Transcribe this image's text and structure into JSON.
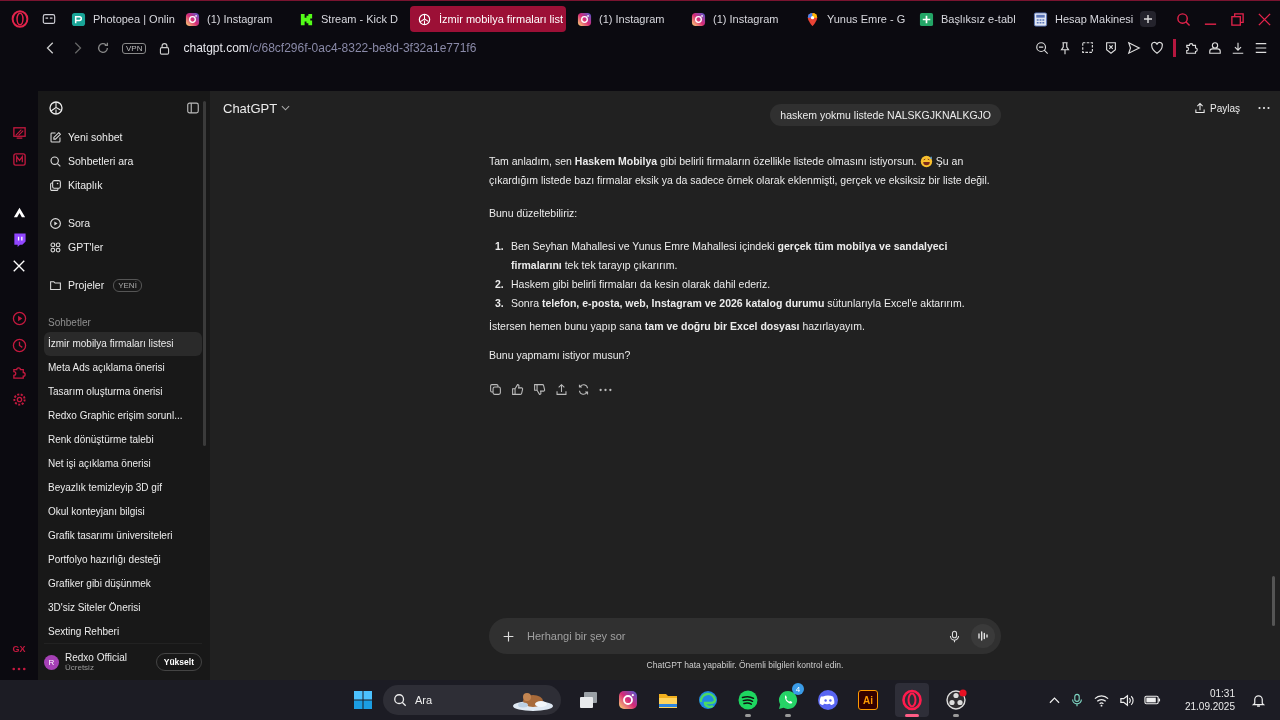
{
  "browser": {
    "tabs": [
      {
        "kind": "photopea",
        "label": "Photopea | Onlin",
        "selected": false
      },
      {
        "kind": "instagram",
        "label": "(1) Instagram",
        "selected": false
      },
      {
        "kind": "kick",
        "label": "Stream - Kick D",
        "selected": false
      },
      {
        "kind": "chatgpt",
        "label": "İzmir mobilya firmaları list",
        "selected": true
      },
      {
        "kind": "instagram",
        "label": "(1) Instagram",
        "selected": false
      },
      {
        "kind": "instagram",
        "label": "(1) Instagram",
        "selected": false
      },
      {
        "kind": "maps",
        "label": "Yunus Emre - G",
        "selected": false
      },
      {
        "kind": "sheets",
        "label": "Başlıksız e-tabl",
        "selected": false
      },
      {
        "kind": "calculator",
        "label": "Hesap Makinesi",
        "selected": false
      }
    ],
    "address": {
      "vpn": "VPN",
      "domain": "chatgpt.com",
      "path": "/c/68cf296f-0ac4-8322-be8d-3f32a1e771f6"
    },
    "rail_label": "GX"
  },
  "chatgpt_sidebar": {
    "nav": [
      {
        "kind": "edit",
        "label": "Yeni sohbet"
      },
      {
        "kind": "search",
        "label": "Sohbetleri ara"
      },
      {
        "kind": "library",
        "label": "Kitaplık"
      },
      {
        "kind": "sora",
        "label": "Sora"
      },
      {
        "kind": "gpts",
        "label": "GPT'ler"
      }
    ],
    "projects": {
      "label": "Projeler",
      "badge": "YENİ"
    },
    "section": "Sohbetler",
    "chats": [
      {
        "label": "İzmir mobilya firmaları listesi",
        "selected": true
      },
      {
        "label": "Meta Ads açıklama önerisi",
        "selected": false
      },
      {
        "label": "Tasarım oluşturma önerisi",
        "selected": false
      },
      {
        "label": "Redxo Graphic erişim sorunl...",
        "selected": false
      },
      {
        "label": "Renk dönüştürme talebi",
        "selected": false
      },
      {
        "label": "Net işi açıklama önerisi",
        "selected": false
      },
      {
        "label": "Beyazlık temizleyip 3D gif",
        "selected": false
      },
      {
        "label": "Okul konteyjanı bilgisi",
        "selected": false
      },
      {
        "label": "Grafik tasarımı üniversiteleri",
        "selected": false
      },
      {
        "label": "Portfolyo hazırlığı desteği",
        "selected": false
      },
      {
        "label": "Grafiker gibi düşünmek",
        "selected": false
      },
      {
        "label": "3D'siz Siteler Önerisi",
        "selected": false
      },
      {
        "label": "Sexting Rehberi",
        "selected": false
      }
    ],
    "user": {
      "initial": "R",
      "name": "Redxo Official",
      "plan": "Ücretsiz",
      "upgrade": "Yükselt"
    }
  },
  "header": {
    "model": "ChatGPT",
    "share": "Paylaş"
  },
  "conversation": {
    "user_message": "haskem yokmu listede NALSKGJKNALKGJO",
    "intro_before_emoji": "Tam anladım, sen **Haskem Mobilya** gibi belirli firmaların özellikle listede olmasını istiyorsun.",
    "intro_after_emoji": "Şu an",
    "intro_second_line": "çıkardığım listede bazı firmalar eksik ya da sadece örnek olarak eklenmişti, gerçek ve eksiksiz bir liste değil.",
    "lead": "Bunu düzeltebiliriz:",
    "steps": [
      {
        "number": "1.",
        "text": "Ben Seyhan Mahallesi ve Yunus Emre Mahallesi içindeki **gerçek tüm mobilya ve sandalyeci firmalarını** tek tek tarayıp çıkarırım."
      },
      {
        "number": "2.",
        "text": "Haskem gibi belirli firmaları da kesin olarak dahil ederiz."
      },
      {
        "number": "3.",
        "text": "Sonra **telefon, e-posta, web, Instagram ve 2026 katalog durumu** sütunlarıyla Excel'e aktarırım."
      }
    ],
    "offer": "İstersen hemen bunu yapıp sana **tam ve doğru bir Excel dosyası** hazırlayayım.",
    "question": "Bunu yapmamı istiyor musun?"
  },
  "composer": {
    "placeholder": "Herhangi bir şey sor",
    "disclaimer": "ChatGPT hata yapabilir. Önemli bilgileri kontrol edin."
  },
  "taskbar": {
    "search": "Ara",
    "apps": [
      {
        "kind": "taskview",
        "running": false,
        "selected": false
      },
      {
        "kind": "instagram",
        "running": false,
        "selected": false
      },
      {
        "kind": "files",
        "running": false,
        "selected": false
      },
      {
        "kind": "edge",
        "running": false,
        "selected": false
      },
      {
        "kind": "spotify",
        "running": true,
        "selected": false
      },
      {
        "kind": "whatsapp",
        "running": true,
        "selected": false,
        "badge": "4"
      },
      {
        "kind": "discord",
        "running": false,
        "selected": false
      },
      {
        "kind": "illustrator",
        "running": false,
        "selected": false,
        "label": "Ai"
      },
      {
        "kind": "opera",
        "running": true,
        "selected": true
      },
      {
        "kind": "obs",
        "running": true,
        "selected": false
      }
    ],
    "time": "01:31",
    "date": "21.09.2025"
  }
}
